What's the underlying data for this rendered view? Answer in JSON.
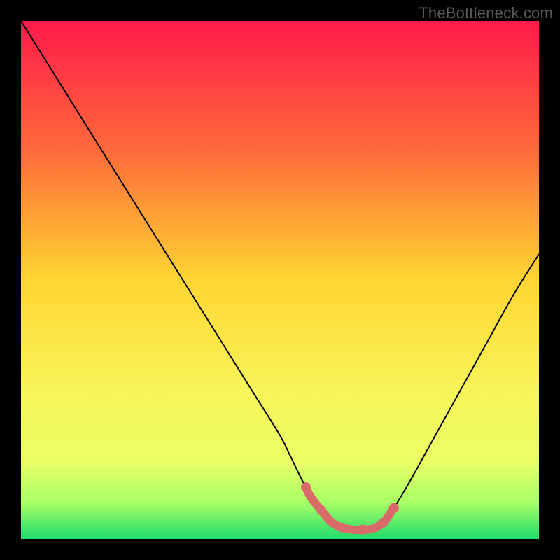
{
  "watermark": "TheBottleneck.com",
  "chart_data": {
    "type": "line",
    "title": "",
    "xlabel": "",
    "ylabel": "",
    "xlim": [
      0,
      100
    ],
    "ylim": [
      0,
      100
    ],
    "grid": false,
    "legend": false,
    "background": {
      "type": "vertical-gradient",
      "stops": [
        {
          "pos": 0.0,
          "color": "#ff1a4b"
        },
        {
          "pos": 0.25,
          "color": "#ff6a3a"
        },
        {
          "pos": 0.5,
          "color": "#ffd633"
        },
        {
          "pos": 0.72,
          "color": "#f7f55a"
        },
        {
          "pos": 0.85,
          "color": "#eaff66"
        },
        {
          "pos": 0.93,
          "color": "#a8ff66"
        },
        {
          "pos": 1.0,
          "color": "#1fdc6b"
        }
      ]
    },
    "series": [
      {
        "name": "bottleneck-curve",
        "color": "#000000",
        "x": [
          0,
          5,
          10,
          15,
          20,
          25,
          30,
          35,
          40,
          45,
          50,
          52,
          55,
          58,
          60,
          62,
          64,
          66,
          68,
          70,
          72,
          75,
          80,
          85,
          90,
          95,
          100
        ],
        "y": [
          100,
          92,
          84,
          76,
          68,
          60,
          52,
          44,
          36,
          28,
          20,
          16,
          10,
          5.5,
          3.2,
          2.2,
          1.8,
          1.8,
          2.0,
          3.2,
          6.0,
          11,
          20,
          29,
          38,
          47,
          55
        ]
      }
    ],
    "highlight": {
      "name": "optimal-range",
      "color": "#d96a6a",
      "points": [
        {
          "x": 55,
          "y": 10.0
        },
        {
          "x": 56,
          "y": 8.0
        },
        {
          "x": 58,
          "y": 5.5
        },
        {
          "x": 60,
          "y": 3.2
        },
        {
          "x": 62,
          "y": 2.2
        },
        {
          "x": 64,
          "y": 1.8
        },
        {
          "x": 66,
          "y": 1.8
        },
        {
          "x": 68,
          "y": 2.0
        },
        {
          "x": 70,
          "y": 3.2
        },
        {
          "x": 71,
          "y": 4.5
        },
        {
          "x": 72,
          "y": 6.0
        }
      ]
    }
  }
}
